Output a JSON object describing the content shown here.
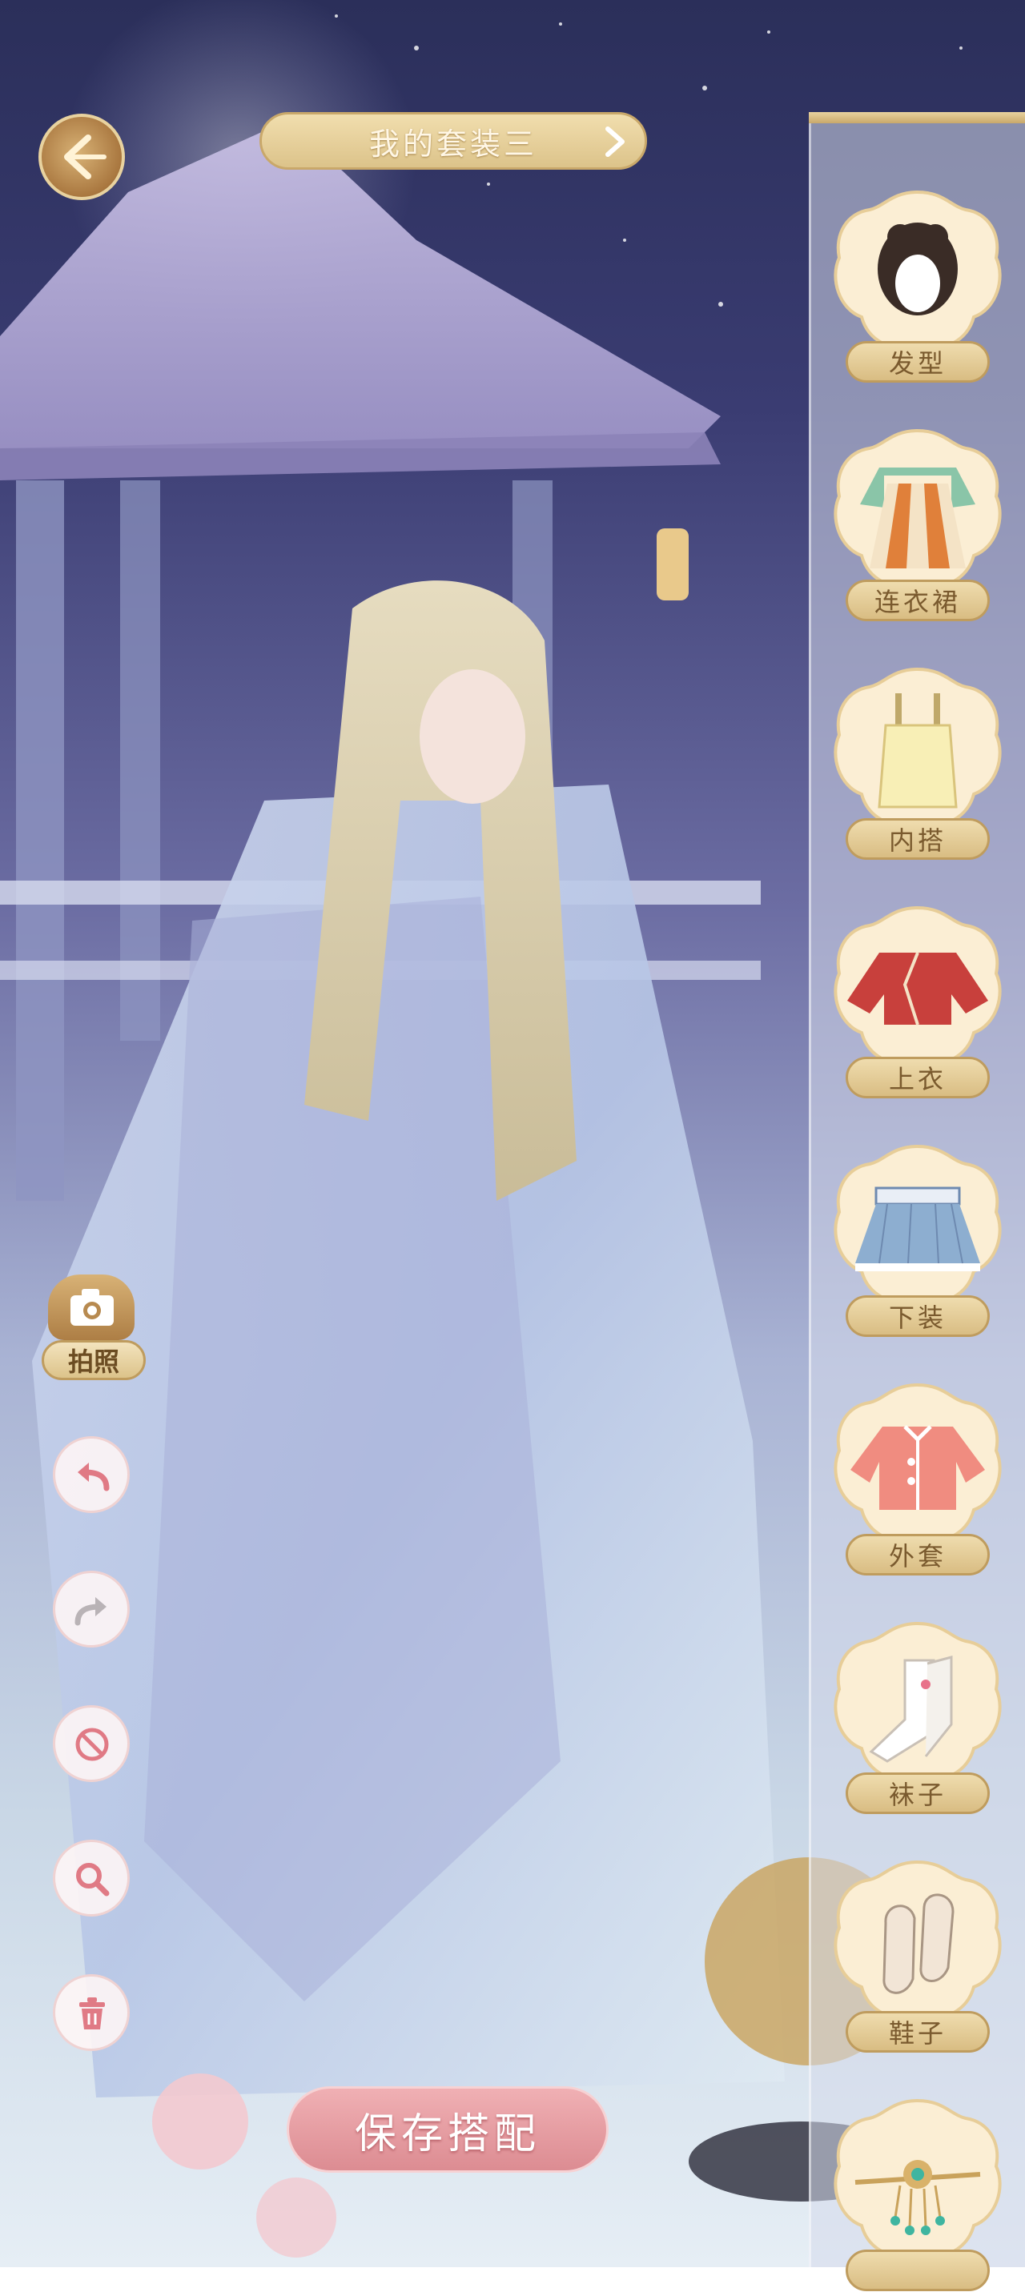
{
  "header": {
    "outfit_name": "我的套装三"
  },
  "categories": [
    {
      "label": "发型",
      "icon": "hairstyle-icon"
    },
    {
      "label": "连衣裙",
      "icon": "dress-icon"
    },
    {
      "label": "内搭",
      "icon": "inner-top-icon"
    },
    {
      "label": "上衣",
      "icon": "top-icon"
    },
    {
      "label": "下装",
      "icon": "skirt-icon"
    },
    {
      "label": "外套",
      "icon": "coat-icon"
    },
    {
      "label": "袜子",
      "icon": "socks-icon"
    },
    {
      "label": "鞋子",
      "icon": "shoes-icon"
    },
    {
      "label": "",
      "icon": "hair-ornament-icon"
    }
  ],
  "tools": {
    "photo_label": "拍照",
    "undo": "undo-icon",
    "redo": "redo-icon",
    "clear": "prohibit-icon",
    "zoom": "magnifier-icon",
    "delete": "trash-icon"
  },
  "actions": {
    "save_label": "保存搭配"
  },
  "colors": {
    "accent_gold": "#d8b276",
    "save_pink": "#e49aa0",
    "label_text": "#7a5a2e"
  }
}
